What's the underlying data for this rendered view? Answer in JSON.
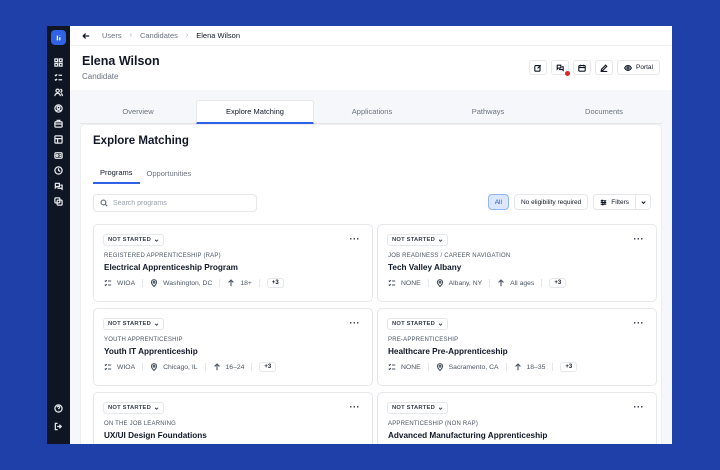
{
  "breadcrumbs": [
    "Users",
    "Candidates",
    "Elena Wilson"
  ],
  "page": {
    "title": "Elena Wilson",
    "subtitle": "Candidate"
  },
  "header_actions": {
    "portal_label": "Portal"
  },
  "tabs": [
    "Overview",
    "Explore Matching",
    "Applications",
    "Pathways",
    "Documents"
  ],
  "active_tab": "Explore Matching",
  "panel": {
    "title": "Explore Matching",
    "subtabs": [
      "Programs",
      "Opportunities"
    ],
    "active_subtab": "Programs"
  },
  "search": {
    "placeholder": "Search programs"
  },
  "filters": {
    "all_label": "All",
    "eligibility_label": "No eligibility required",
    "filters_label": "Filters"
  },
  "cards": [
    {
      "status": "NOT STARTED",
      "category": "REGISTERED APPRENTICESHIP (RAP)",
      "name": "Electrical Apprenticeship Program",
      "funding": "WIOA",
      "location": "Washington, DC",
      "age": "18+",
      "more": "+3"
    },
    {
      "status": "NOT STARTED",
      "category": "JOB READINESS / CAREER NAVIGATION",
      "name": "Tech Valley Albany",
      "funding": "NONE",
      "location": "Albany, NY",
      "age": "All ages",
      "more": "+3"
    },
    {
      "status": "NOT STARTED",
      "category": "YOUTH APPRENTICESHIP",
      "name": "Youth IT Apprenticeship",
      "funding": "WIOA",
      "location": "Chicago, IL",
      "age": "16–24",
      "more": "+3"
    },
    {
      "status": "NOT STARTED",
      "category": "PRE-APPRENTICESHIP",
      "name": "Healthcare Pre-Apprenticeship",
      "funding": "NONE",
      "location": "Sacramento, CA",
      "age": "18–35",
      "more": "+3"
    },
    {
      "status": "NOT STARTED",
      "category": "ON THE JOB LEARNING",
      "name": "UX/UI Design Foundations"
    },
    {
      "status": "NOT STARTED",
      "category": "APPRENTICESHIP (NON RAP)",
      "name": "Advanced Manufacturing Apprenticeship"
    }
  ],
  "colors": {
    "background": "#1e40a8",
    "sidebar": "#0f1522",
    "accent": "#2f62e6",
    "notification": "#dc2626"
  },
  "icons": {
    "sidebar": [
      "app-logo-icon",
      "grid-icon",
      "checklist-icon",
      "users-icon",
      "user-circle-icon",
      "briefcase-icon",
      "table-icon",
      "id-card-icon",
      "clock-icon",
      "chat-icon",
      "copy-icon",
      "help-icon",
      "logout-icon"
    ],
    "card_meta": [
      "funding-list-icon",
      "location-pin-icon",
      "age-arrow-icon"
    ]
  }
}
